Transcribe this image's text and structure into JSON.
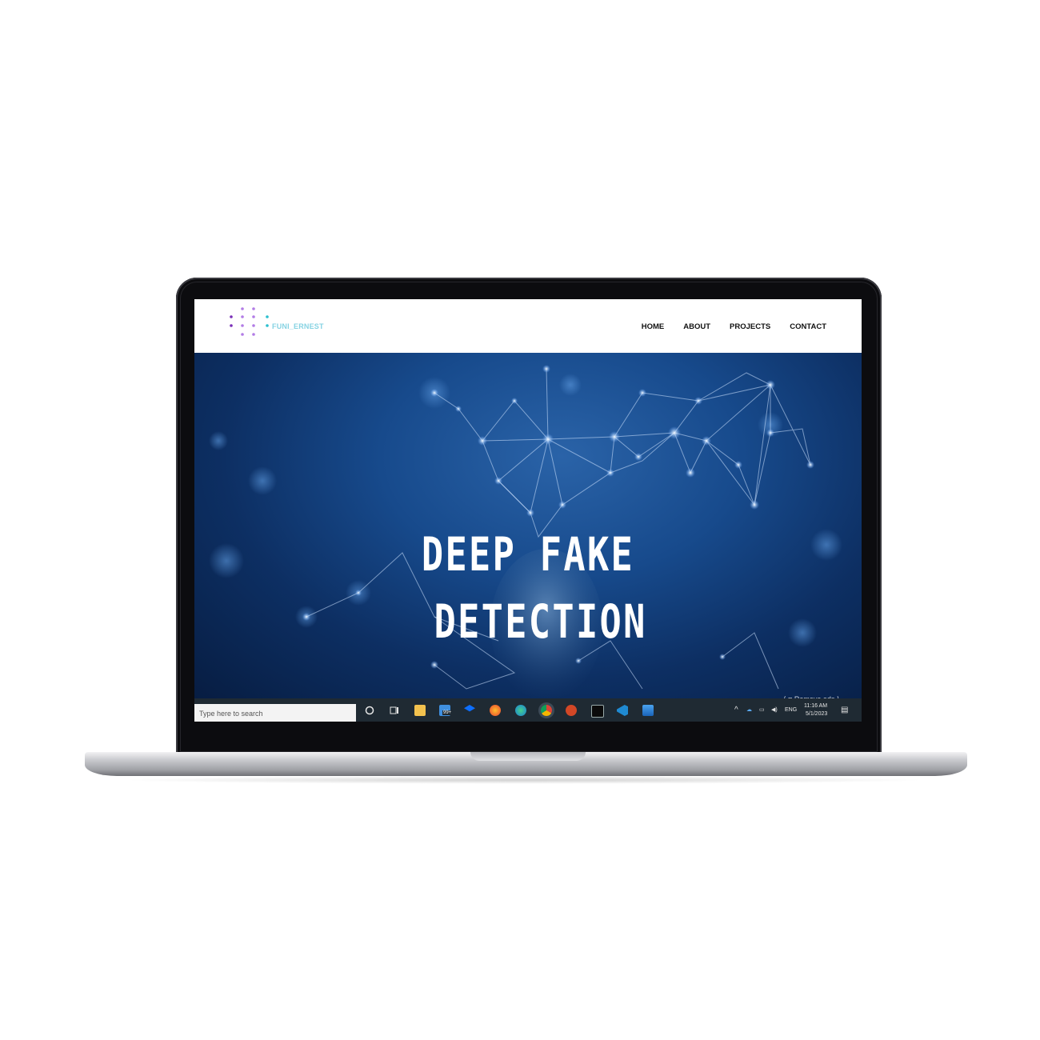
{
  "brand": {
    "name": "FUNI_ERNEST",
    "text_color": "#86d3e3",
    "dot_colors": [
      "#7a2fb8",
      "#b27ce6",
      "#2bbfcf"
    ]
  },
  "nav": {
    "items": [
      {
        "label": "HOME"
      },
      {
        "label": "ABOUT"
      },
      {
        "label": "PROJECTS"
      },
      {
        "label": "CONTACT"
      }
    ]
  },
  "hero": {
    "title_line1": "DEEP FAKE",
    "title_line2": "DETECTION",
    "background_color": "#174a8c"
  },
  "overlay": {
    "remove_ads": "Remove ads"
  },
  "taskbar": {
    "search_placeholder": "Type here to search",
    "mail_badge": "99+",
    "language": "ENG",
    "time": "11:16 AM",
    "date": "5/1/2023",
    "icons": [
      "cortana-icon",
      "task-view-icon",
      "file-explorer-icon",
      "mail-icon",
      "dropbox-icon",
      "firefox-icon",
      "edge-icon",
      "chrome-icon",
      "powerpoint-icon",
      "terminal-icon",
      "vscode-icon",
      "photos-icon"
    ]
  }
}
